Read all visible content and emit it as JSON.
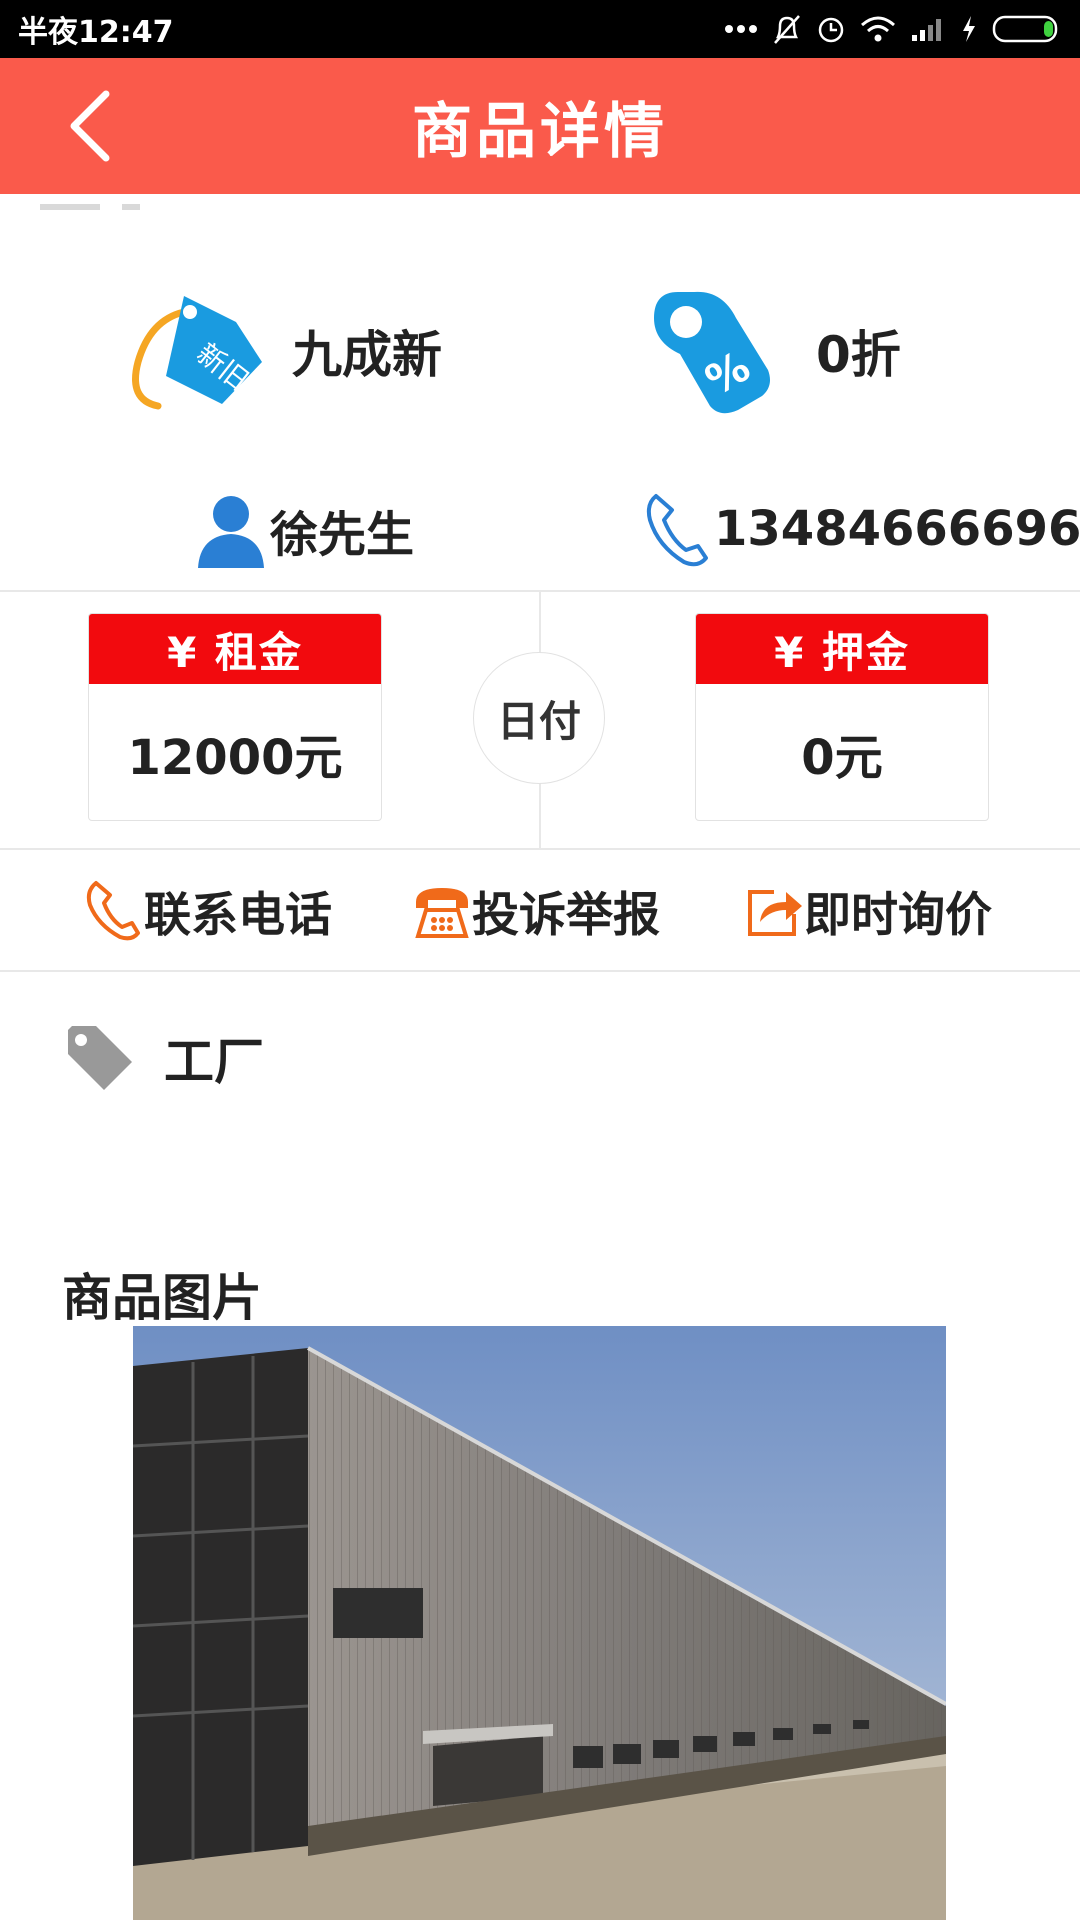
{
  "status_bar": {
    "time": "半夜12:47"
  },
  "header": {
    "title": "商品详情"
  },
  "condition": {
    "label": "九成新",
    "icon_text": "新旧"
  },
  "discount": {
    "label": "0折"
  },
  "contact": {
    "name": "徐先生",
    "phone": "13484666696"
  },
  "rent": {
    "label": "¥ 租金",
    "value": "12000元"
  },
  "payment": {
    "label": "日付"
  },
  "deposit": {
    "label": "¥ 押金",
    "value": "0元"
  },
  "actions": [
    {
      "label": "联系电话",
      "icon": "phone-icon"
    },
    {
      "label": "投诉举报",
      "icon": "telephone-icon"
    },
    {
      "label": "即时询价",
      "icon": "share-icon"
    }
  ],
  "category": {
    "label": "工厂"
  },
  "images_section": {
    "title": "商品图片"
  },
  "colors": {
    "accent": "#fa5a4b",
    "price_header": "#f20a0e",
    "icon_blue": "#1a9be0",
    "action_orange": "#f06a1a"
  }
}
